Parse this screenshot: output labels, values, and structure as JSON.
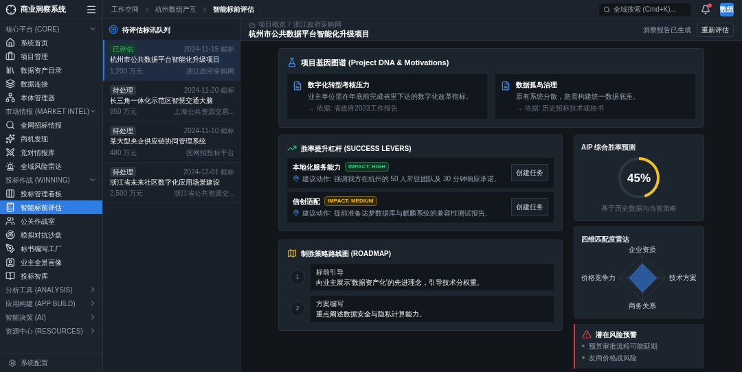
{
  "app": {
    "title": "商业洞察系统"
  },
  "sidebar": {
    "sections": [
      {
        "label": "核心平台 (CORE)",
        "expanded": true,
        "items": [
          {
            "label": "系统首页",
            "selected": false
          },
          {
            "label": "项目管理",
            "selected": false
          },
          {
            "label": "数据资产目录",
            "selected": false
          },
          {
            "label": "数据连接",
            "selected": false
          },
          {
            "label": "本体管理器",
            "selected": false
          }
        ]
      },
      {
        "label": "市场情报 (MARKET INTEL)",
        "expanded": true,
        "items": [
          {
            "label": "全网招标情报",
            "selected": false
          },
          {
            "label": "商机发现",
            "selected": false
          },
          {
            "label": "竞对情报库",
            "selected": false
          },
          {
            "label": "全域风险雷达",
            "selected": false
          }
        ]
      },
      {
        "label": "投标作战 (WINNING)",
        "expanded": true,
        "items": [
          {
            "label": "投标管理看板",
            "selected": false
          },
          {
            "label": "智能标前评估",
            "selected": true
          },
          {
            "label": "公关作战室",
            "selected": false
          },
          {
            "label": "模拟对抗沙盘",
            "selected": false
          },
          {
            "label": "标书编写工厂",
            "selected": false
          },
          {
            "label": "业主全景画像",
            "selected": false
          },
          {
            "label": "投标智库",
            "selected": false
          }
        ]
      },
      {
        "label": "分析工具 (ANALYSIS)",
        "expanded": false
      },
      {
        "label": "应用构建 (APP BUILD)",
        "expanded": false
      },
      {
        "label": "智能决策 (AI)",
        "expanded": false
      },
      {
        "label": "资源中心 (RESOURCES)",
        "expanded": false
      }
    ],
    "footer": {
      "label": "系统配置"
    }
  },
  "breadcrumb": [
    "工作空间",
    "杭州数组产互",
    "智能标前评估"
  ],
  "search": {
    "placeholder": "全域搜索 (Cmd+K)..."
  },
  "notifications": {
    "unread": true
  },
  "user": {
    "avatar": "数组"
  },
  "queue": {
    "title": "待评估标讯队列",
    "items": [
      {
        "status": "已评估",
        "kind": "done",
        "deadline": "2024-11-15 截标",
        "title": "杭州市公共数据平台智能化升级项目",
        "amount": "1,200 万元",
        "source": "浙江政府采购网",
        "selected": true
      },
      {
        "status": "待处理",
        "kind": "pending",
        "deadline": "2024-11-20 截标",
        "title": "长三角一体化示范区智慧交通大脑",
        "amount": "850 万元",
        "source": "上海公共资源交易...",
        "selected": false
      },
      {
        "status": "待处理",
        "kind": "pending",
        "deadline": "2024-11-10 截标",
        "title": "某大型央企供应链协同管理系统",
        "amount": "480 万元",
        "source": "国网招投标平台",
        "selected": false
      },
      {
        "status": "待处理",
        "kind": "pending",
        "deadline": "2024-12-01 截标",
        "title": "浙江省未来社区数字化应用场景建设",
        "amount": "2,500 万元",
        "source": "浙江省公共资源交...",
        "selected": false
      }
    ]
  },
  "project": {
    "breadcrumb": [
      "项目概览",
      "浙江政府采购网"
    ],
    "breadcrumb_separator": "/",
    "title": "杭州市公共数据平台智能化升级项目",
    "report_status": "洞察报告已生成",
    "reassess_button": "重新评估"
  },
  "dna": {
    "title": "项目基因图谱 (Project DNA & Motivations)",
    "cards": [
      {
        "title": "数字化转型考核压力",
        "text": "业主单位需在年底前完成省里下达的数字化改革指标。",
        "basis": "→ 依据: 省政府2023工作报告"
      },
      {
        "title": "数据孤岛治理",
        "text": "原有系统分散，急需构建统一数据底座。",
        "basis": "→ 依据: 历史招标技术规格书"
      }
    ]
  },
  "levers": {
    "title": "胜率提升杠杆 (SUCCESS LEVERS)",
    "items": [
      {
        "name": "本地化服务能力",
        "impact": "IMPACT: HIGH",
        "kind": "high",
        "action": "建议动作: 强调我方在杭州的 50 人常驻团队及 30 分钟响应承诺。",
        "button": "创建任务"
      },
      {
        "name": "信创适配",
        "impact": "IMPACT: MEDIUM",
        "kind": "medium",
        "action": "建议动作: 提前准备达梦数据库与麒麟系统的兼容性测试报告。",
        "button": "创建任务"
      }
    ]
  },
  "roadmap": {
    "title": "制胜策略路线图 (ROADMAP)",
    "steps": [
      {
        "number": "1",
        "title": "标前引导",
        "text": "向业主展示'数据资产化'的先进理念，引导技术分权重。"
      },
      {
        "number": "2",
        "title": "方案编写",
        "text": "重点阐述数据安全与隐私计算能力。"
      }
    ]
  },
  "win_rate": {
    "title": "AIP 综合胜率预测",
    "value": "45%",
    "level": 0.45,
    "note": "基于历史数据与当前策略"
  },
  "radar": {
    "title": "四维匹配度雷达",
    "axes": [
      "企业资质",
      "技术方案",
      "商务关系",
      "价格竞争力"
    ]
  },
  "risks": {
    "title": "潜在风险预警",
    "items": [
      "预算审批流程可能延期",
      "友商价格战风险"
    ]
  }
}
